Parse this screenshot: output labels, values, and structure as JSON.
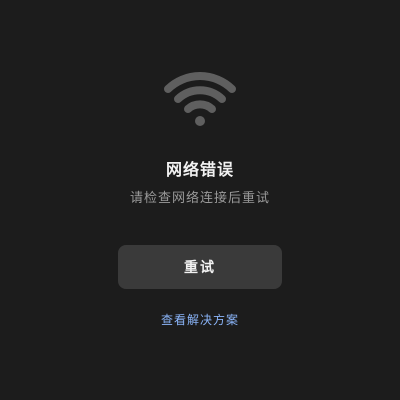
{
  "error": {
    "icon": "wifi-icon",
    "icon_color": "#5f5f5f",
    "title": "网络错误",
    "message": "请检查网络连接后重试"
  },
  "actions": {
    "retry_label": "重试",
    "help_link_label": "查看解决方案",
    "link_color": "#8ab4f8"
  }
}
